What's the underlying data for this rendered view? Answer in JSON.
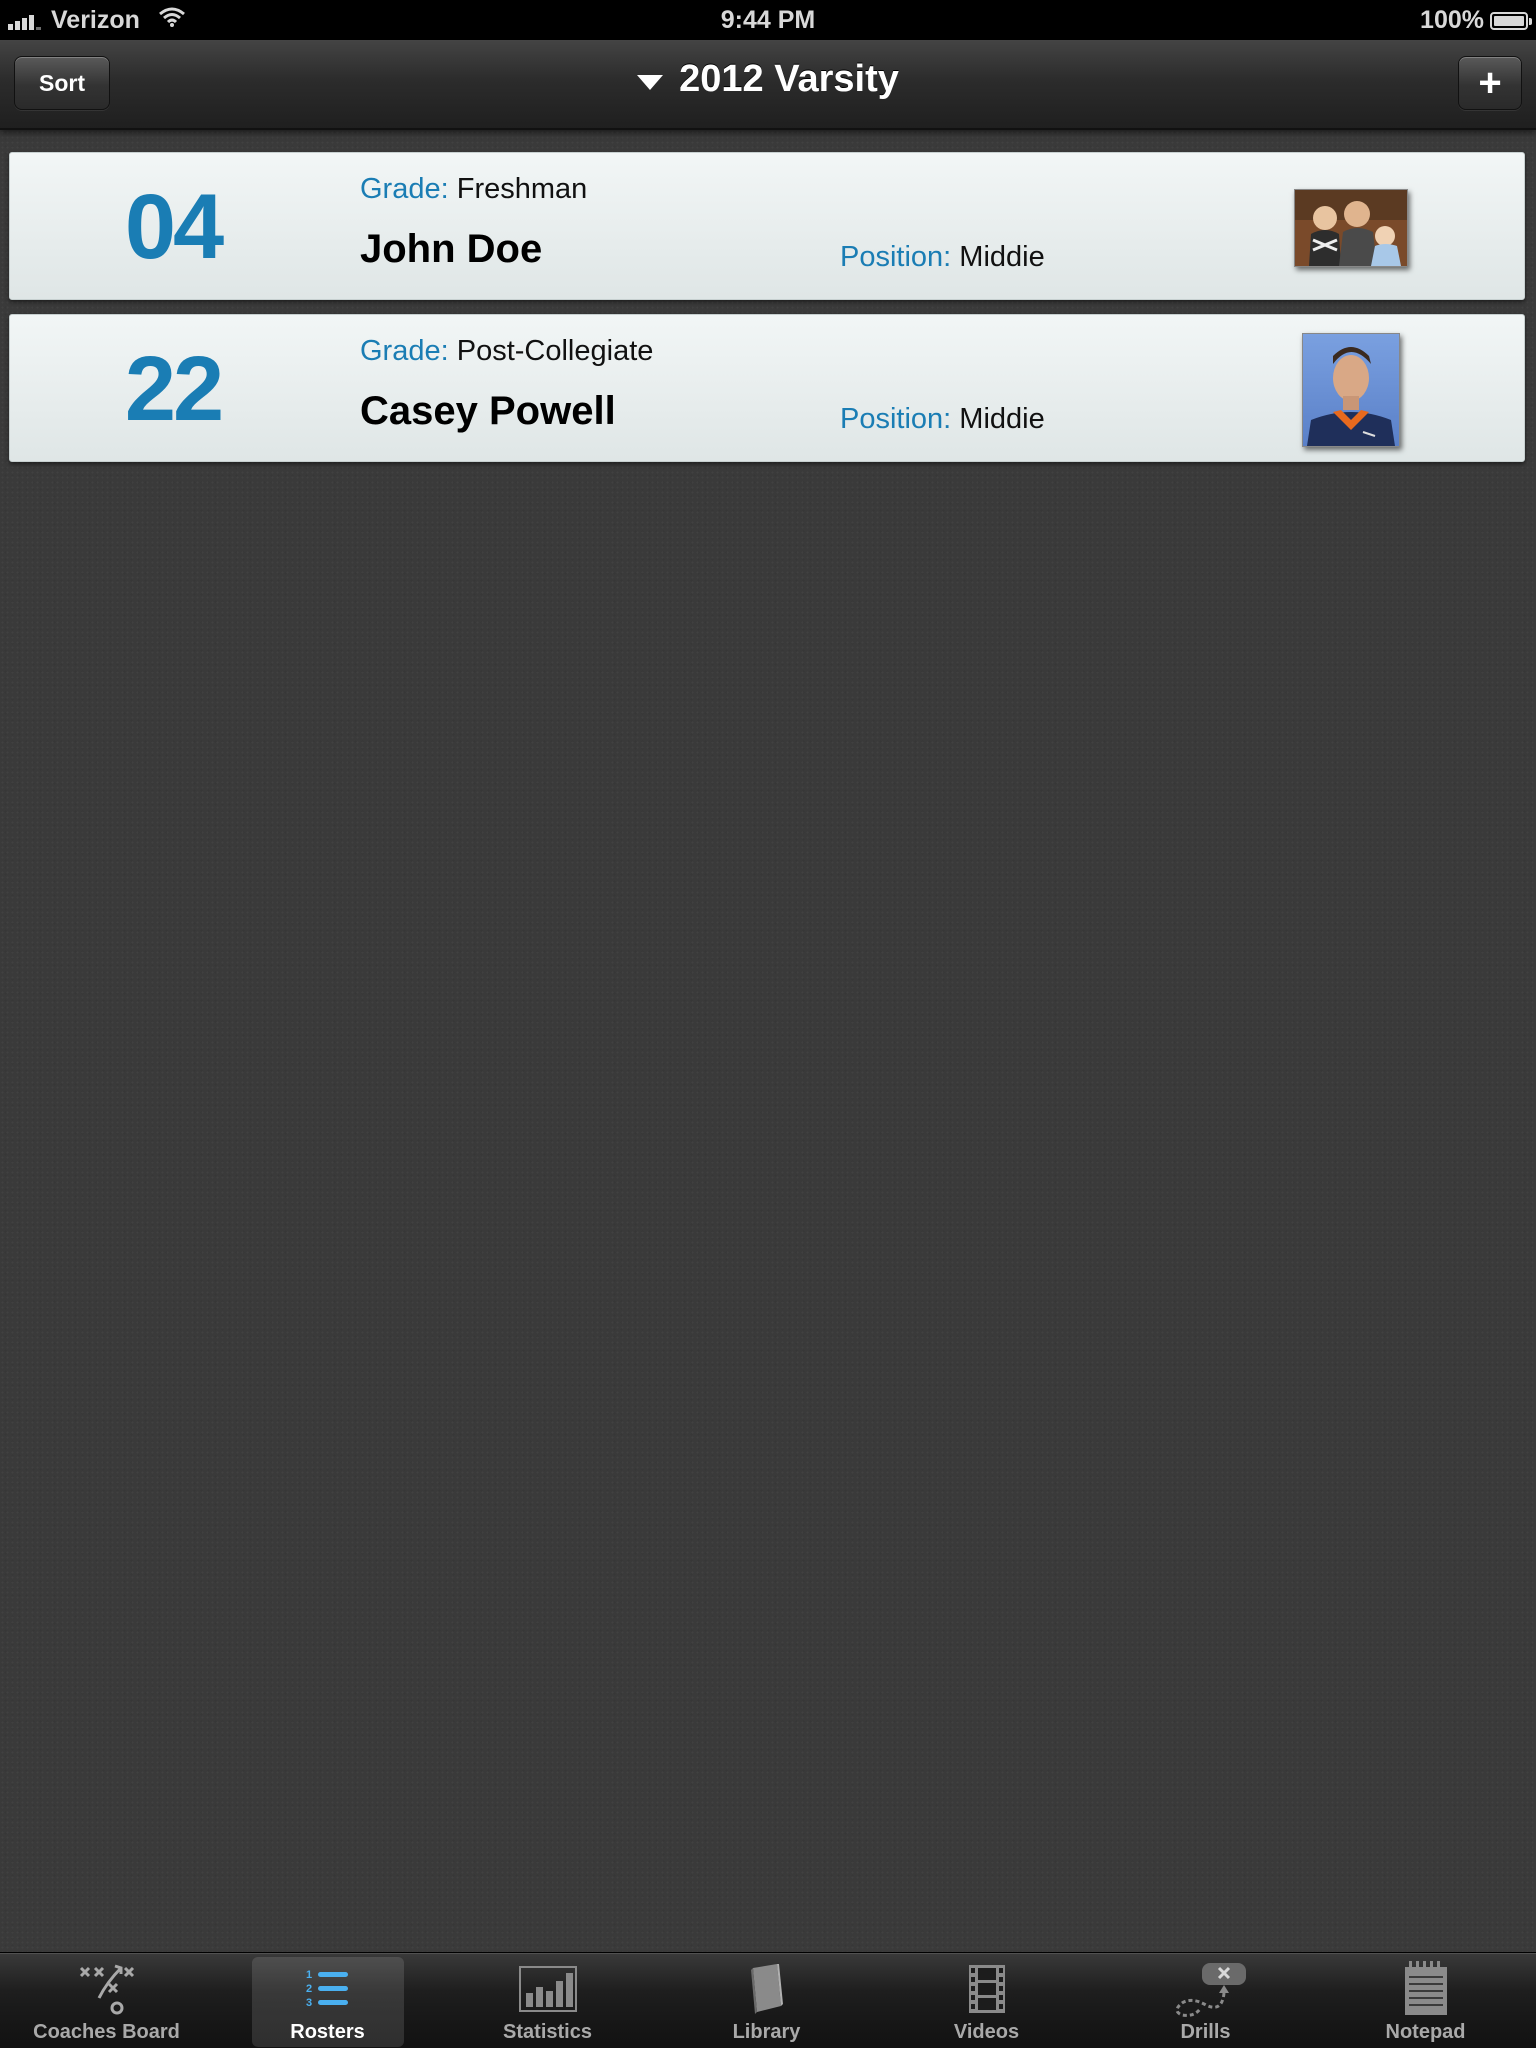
{
  "status_bar": {
    "carrier": "Verizon",
    "time": "9:44 PM",
    "battery": "100%"
  },
  "nav": {
    "sort_label": "Sort",
    "title": "2012 Varsity",
    "add_label": "+"
  },
  "labels": {
    "grade": "Grade:",
    "position": "Position:"
  },
  "roster": [
    {
      "number": "04",
      "grade": "Freshman",
      "name": "John Doe",
      "position": "Middie"
    },
    {
      "number": "22",
      "grade": "Post-Collegiate",
      "name": "Casey Powell",
      "position": "Middie"
    }
  ],
  "tabs": [
    {
      "label": "Coaches Board",
      "icon": "play-diagram-icon",
      "active": false
    },
    {
      "label": "Rosters",
      "icon": "numbered-list-icon",
      "active": true
    },
    {
      "label": "Statistics",
      "icon": "bar-chart-icon",
      "active": false
    },
    {
      "label": "Library",
      "icon": "book-icon",
      "active": false
    },
    {
      "label": "Videos",
      "icon": "film-icon",
      "active": false
    },
    {
      "label": "Drills",
      "icon": "drill-path-icon",
      "active": false
    },
    {
      "label": "Notepad",
      "icon": "notepad-icon",
      "active": false
    }
  ],
  "colors": {
    "accent_blue": "#1a7db4",
    "row_background": "#eaf0f0",
    "page_background": "#3a3a3a",
    "active_tab_icon": "#4ab0f0"
  }
}
